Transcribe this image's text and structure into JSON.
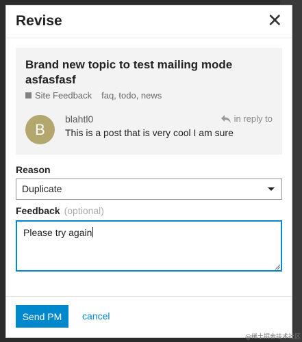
{
  "dialog": {
    "title": "Revise",
    "close_icon": "close-icon"
  },
  "topic": {
    "title": "Brand new topic to test mailing mode asfasfasf",
    "category": "Site Feedback",
    "category_color": "#808281",
    "tags": "faq,  todo,  news"
  },
  "post": {
    "avatar_letter": "B",
    "avatar_color": "#b3a76e",
    "username": "blahtl0",
    "reply_label": "in reply to",
    "reply_icon": "reply-arrow-icon",
    "text": "This is a post that is very cool I am sure"
  },
  "form": {
    "reason_label": "Reason",
    "reason_selected": "Duplicate",
    "feedback_label": "Feedback",
    "feedback_optional": "(optional)",
    "feedback_value": "Please try again"
  },
  "footer": {
    "send_label": "Send PM",
    "cancel_label": "cancel",
    "accent_color": "#0088cc"
  },
  "watermark": "@稀土掘金技术社区"
}
